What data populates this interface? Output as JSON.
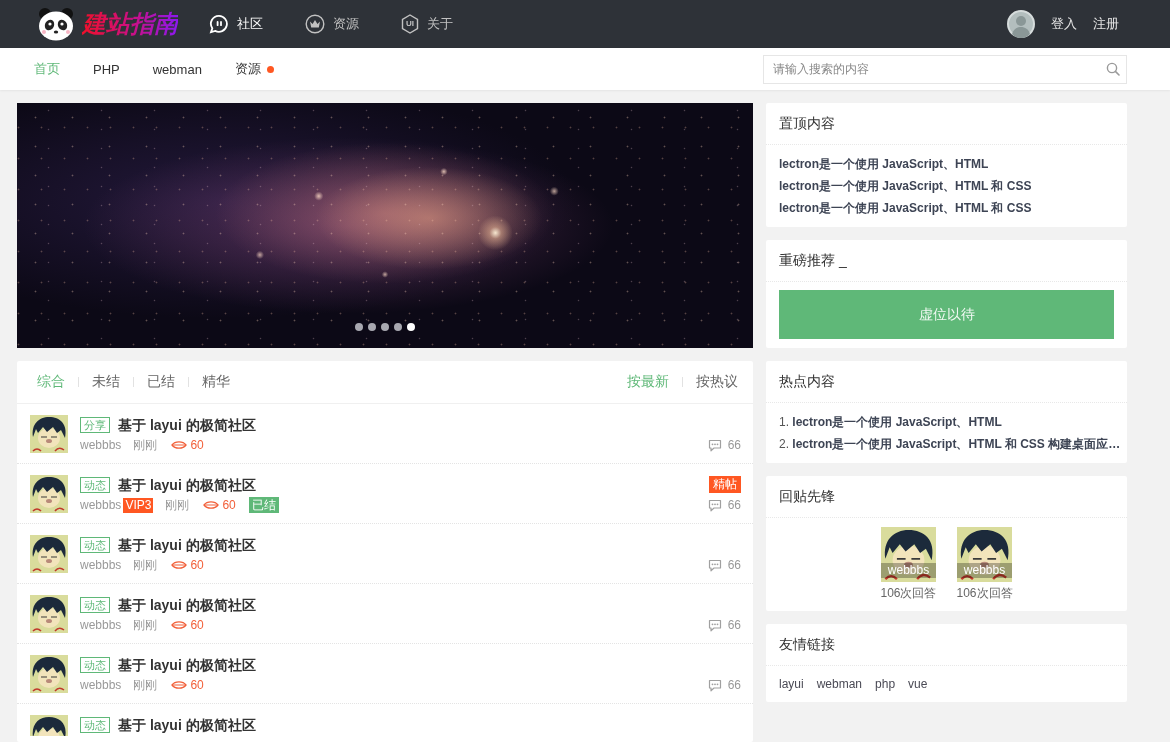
{
  "header": {
    "logo_text": "建站指南",
    "nav": [
      {
        "label": "社区",
        "selected": true
      },
      {
        "label": "资源",
        "selected": false
      },
      {
        "label": "关于",
        "selected": false,
        "icon_text": "UI"
      }
    ],
    "user_links": [
      "登入",
      "注册"
    ]
  },
  "subnav": {
    "items": [
      {
        "label": "首页",
        "selected": true,
        "dot": false
      },
      {
        "label": "PHP",
        "selected": false,
        "dot": false
      },
      {
        "label": "webman",
        "selected": false,
        "dot": false
      },
      {
        "label": "资源",
        "selected": false,
        "dot": true
      }
    ],
    "search": {
      "placeholder": "请输入搜索的内容"
    }
  },
  "carousel": {
    "dots": [
      {
        "selected": false
      },
      {
        "selected": false
      },
      {
        "selected": false
      },
      {
        "selected": false
      },
      {
        "selected": true
      }
    ]
  },
  "post_list": {
    "filters": [
      {
        "label": "综合",
        "selected": true
      },
      {
        "label": "未结",
        "selected": false
      },
      {
        "label": "已结",
        "selected": false
      },
      {
        "label": "精华",
        "selected": false
      }
    ],
    "sorts": [
      {
        "label": "按最新",
        "selected": true
      },
      {
        "label": "按热议",
        "selected": false
      }
    ],
    "posts": [
      {
        "tag": "分享",
        "title": "基于 layui 的极简社区",
        "author": "webbbs",
        "time": "刚刚",
        "views": "60",
        "comments": "66"
      },
      {
        "tag": "动态",
        "title": "基于 layui 的极简社区",
        "author": "webbbs",
        "vip": "VIP3",
        "time": "刚刚",
        "views": "60",
        "status": "已结",
        "featured": "精帖",
        "comments": "66"
      },
      {
        "tag": "动态",
        "title": "基于 layui 的极简社区",
        "author": "webbbs",
        "time": "刚刚",
        "views": "60",
        "comments": "66"
      },
      {
        "tag": "动态",
        "title": "基于 layui 的极简社区",
        "author": "webbbs",
        "time": "刚刚",
        "views": "60",
        "comments": "66"
      },
      {
        "tag": "动态",
        "title": "基于 layui 的极简社区",
        "author": "webbbs",
        "time": "刚刚",
        "views": "60",
        "comments": "66"
      },
      {
        "tag": "动态",
        "title": "基于 layui 的极简社区"
      }
    ]
  },
  "sidebar": [
    {
      "kind": "list",
      "title": "置顶内容",
      "items": [
        "lectron是一个使用 JavaScript、HTML",
        "lectron是一个使用 JavaScript、HTML 和 CSS",
        "lectron是一个使用 JavaScript、HTML 和 CSS"
      ]
    },
    {
      "kind": "button",
      "title": "重磅推荐 _",
      "button": "虚位以待"
    },
    {
      "kind": "ranked",
      "title": "热点内容",
      "items": [
        "1. **lectron是一个使用 JavaScript、HTML**",
        "2. **lectron是一个使用 JavaScript、HTML 和 CSS 构建桌面应…**"
      ]
    },
    {
      "kind": "users",
      "title": "回贴先锋",
      "users": [
        {
          "name": "webbbs",
          "replies": "106次回答"
        },
        {
          "name": "webbbs",
          "replies": "106次回答"
        }
      ]
    },
    {
      "kind": "links",
      "title": "友情链接",
      "links": [
        "layui",
        "webman",
        "php",
        "vue"
      ]
    }
  ]
}
